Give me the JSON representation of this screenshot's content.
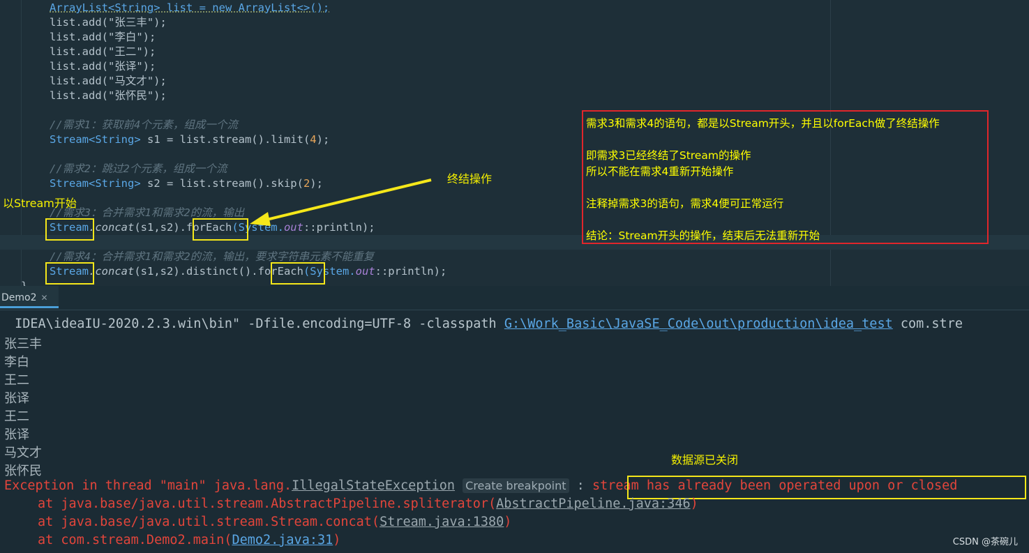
{
  "editor": {
    "lines": [
      "ArrayList<String> list = new ArrayList<>();",
      "list.add(\"张三丰\");",
      "list.add(\"李白\");",
      "list.add(\"王二\");",
      "list.add(\"张译\");",
      "list.add(\"马文才\");",
      "list.add(\"张怀民\");"
    ],
    "comment1": "//需求1：获取前4个元素，组成一个流",
    "code1_a": "Stream",
    "code1_b": "<String>",
    "code1_c": " s1 = list.stream().limit(",
    "code1_num": "4",
    "code1_d": ");",
    "comment2": "//需求2：跳过2个元素，组成一个流",
    "code2_a": "Stream",
    "code2_b": "<String>",
    "code2_c": " s2 = list.stream().skip(",
    "code2_num": "2",
    "code2_d": ");",
    "comment3": "//需求3：合并需求1和需求2的流，输出",
    "comment4": "//需求4：合并需求1和需求2的流，输出，要求字符串元素不能重复",
    "stream_kw": "Stream",
    "concat": ".concat",
    "concat_args": "(s1,s2).",
    "distinct": "distinct().",
    "foreach": "forEach",
    "system_part": "(System.",
    "out": "out",
    "println": "::println);",
    "closing_brace": "}"
  },
  "annotations": {
    "stream_start": "以Stream开始",
    "terminal_op": "终结操作",
    "source_closed": "数据源已关闭",
    "note_lines": [
      "需求3和需求4的语句，都是以Stream开头，并且以forEach做了终结操作",
      "",
      "即需求3已经终结了Stream的操作",
      "所以不能在需求4重新开始操作",
      "",
      "注释掉需求3的语句，需求4便可正常运行",
      "",
      "结论：Stream开头的操作，结束后无法重新开始"
    ],
    "colors": {
      "highlight": "#f5e71a",
      "note_border": "#e0262b"
    }
  },
  "run_panel": {
    "tab_label": "Demo2",
    "cmd_prefix": " IDEA\\ideaIU-2020.2.3.win\\bin\" -Dfile.encoding=UTF-8 -classpath ",
    "cmd_path": "G:\\Work_Basic\\JavaSE_Code\\out\\production\\idea_test",
    "cmd_suffix": " com.stre",
    "output": [
      "张三丰",
      "李白",
      "王二",
      "张译",
      "王二",
      "张译",
      "马文才",
      "张怀民"
    ],
    "exception_prefix": "Exception in thread \"main\" java.lang.",
    "exception_class": "IllegalStateException",
    "create_breakpoint": "Create breakpoint",
    "colon": " : ",
    "exception_msg": "stream has already been operated upon or closed",
    "stack": [
      {
        "text": "at java.base/java.util.stream.AbstractPipeline.spliterator(",
        "link": "AbstractPipeline.java:346",
        "end": ")"
      },
      {
        "text": "at java.base/java.util.stream.Stream.concat(",
        "link": "Stream.java:1380",
        "end": ")"
      },
      {
        "text": "at com.stream.Demo2.main(",
        "link": "Demo2.java:31",
        "end": ")"
      }
    ]
  },
  "watermark": "CSDN @茶碗儿"
}
